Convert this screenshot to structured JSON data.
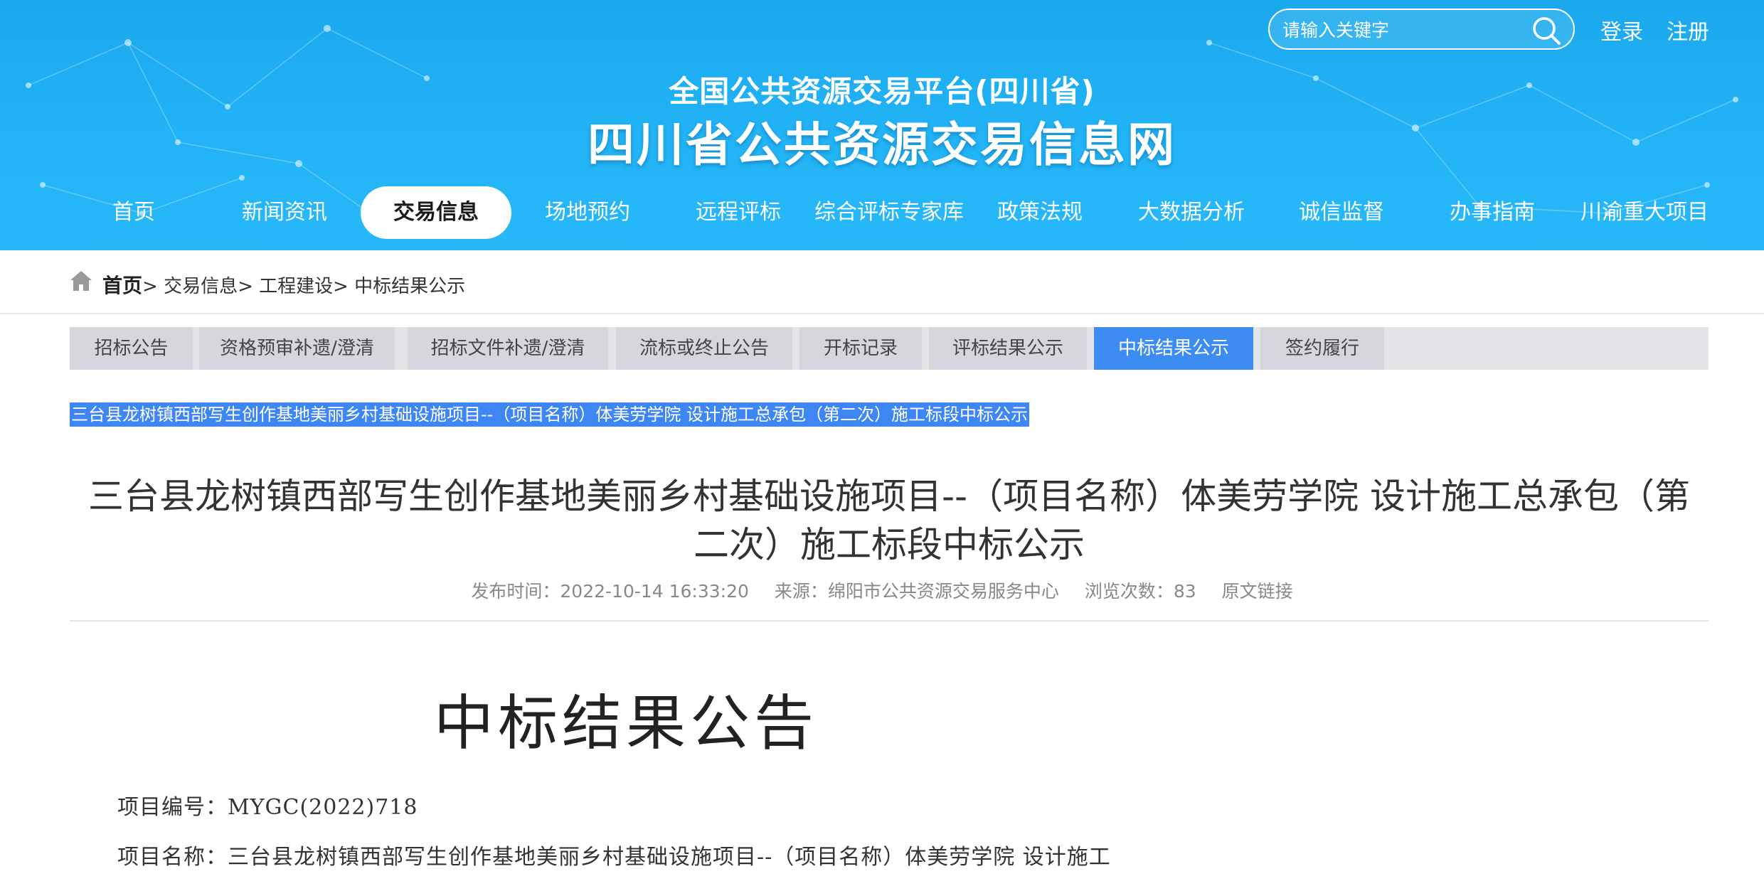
{
  "header": {
    "search_placeholder": "请输入关键字",
    "login": "登录",
    "register": "注册",
    "subtitle": "全国公共资源交易平台(四川省)",
    "title": "四川省公共资源交易信息网",
    "nav": [
      {
        "label": "首页"
      },
      {
        "label": "新闻资讯"
      },
      {
        "label": "交易信息",
        "active": true
      },
      {
        "label": "场地预约"
      },
      {
        "label": "远程评标"
      },
      {
        "label": "综合评标专家库"
      },
      {
        "label": "政策法规"
      },
      {
        "label": "大数据分析"
      },
      {
        "label": "诚信监督"
      },
      {
        "label": "办事指南"
      },
      {
        "label": "川渝重大项目"
      }
    ]
  },
  "breadcrumb": {
    "home": "首页",
    "path": "> 交易信息> 工程建设> 中标结果公示"
  },
  "tabs": [
    {
      "label": "招标公告"
    },
    {
      "label": "资格预审补遗/澄清"
    },
    {
      "label": "招标文件补遗/澄清"
    },
    {
      "label": "流标或终止公告"
    },
    {
      "label": "开标记录"
    },
    {
      "label": "评标结果公示"
    },
    {
      "label": "中标结果公示",
      "active": true
    },
    {
      "label": "签约履行"
    }
  ],
  "selected_text": "三台县龙树镇西部写生创作基地美丽乡村基础设施项目--（项目名称）体美劳学院 设计施工总承包（第二次）施工标段中标公示",
  "article": {
    "title_line1": "三台县龙树镇西部写生创作基地美丽乡村基础设施项目--（项目名称）体美劳学院 设计施工总承包（第",
    "title_line2": "二次）施工标段中标公示",
    "publish_time": "发布时间：2022-10-14 16:33:20",
    "source": "来源：绵阳市公共资源交易服务中心",
    "views": "浏览次数：83",
    "original_link": "原文链接"
  },
  "document": {
    "heading": "中标结果公告",
    "project_code": "项目编号：MYGC(2022)718",
    "project_name": "项目名称：三台县龙树镇西部写生创作基地美丽乡村基础设施项目--（项目名称）体美劳学院 设计施工"
  },
  "colors": {
    "header_blue": "#22b4f6",
    "tab_active": "#3d8cf2",
    "selection": "#3f86f5"
  }
}
